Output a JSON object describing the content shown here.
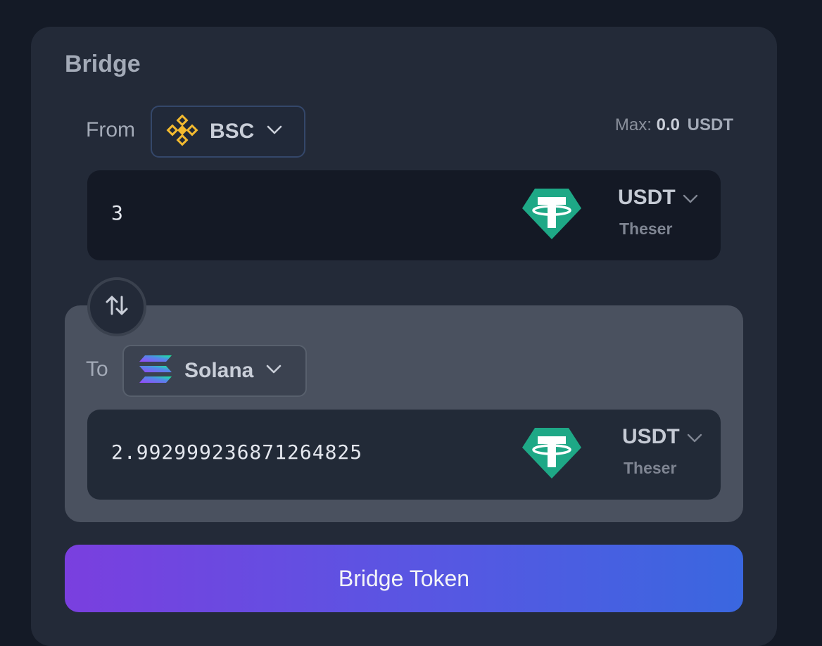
{
  "bridge": {
    "title": "Bridge",
    "from_label": "From",
    "to_label": "To",
    "from_chain": {
      "name": "BSC",
      "icon": "binance-icon"
    },
    "to_chain": {
      "name": "Solana",
      "icon": "solana-icon"
    },
    "max": {
      "label": "Max:",
      "value": "0.0",
      "unit": "USDT"
    },
    "from_amount": "3",
    "to_amount": "2.992999236871264825",
    "from_token": {
      "symbol": "USDT",
      "name": "Theser",
      "icon": "tether-icon"
    },
    "to_token": {
      "symbol": "USDT",
      "name": "Theser",
      "icon": "tether-icon"
    },
    "submit_label": "Bridge Token"
  },
  "colors": {
    "background": "#141a26",
    "card": "#232a38",
    "tether": "#1ea886",
    "binance": "#f3ba2f",
    "button_gradient_start": "#7a3fdf",
    "button_gradient_end": "#3a67e0"
  }
}
